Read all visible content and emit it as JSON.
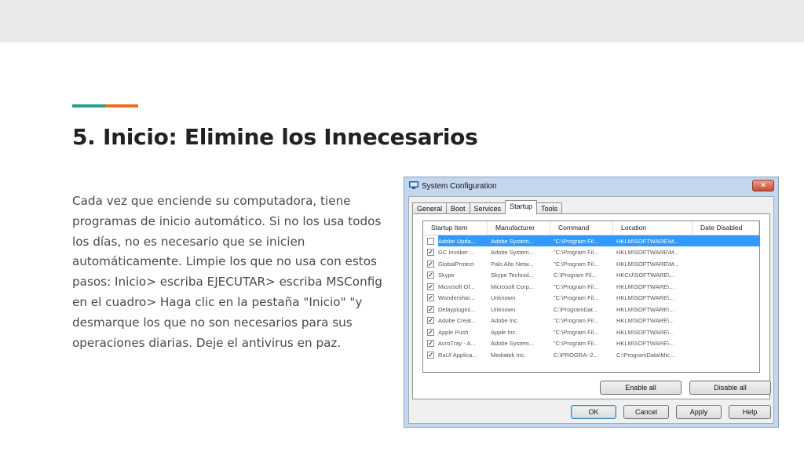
{
  "slide": {
    "title": "5. Inicio: Elimine los Innecesarios",
    "body": "Cada vez que enciende su computadora, tiene programas de inicio automático. Si no los usa todos los días, no es necesario que se inicien automáticamente. Limpie los que no usa con estos pasos: Inicio> escriba EJECUTAR> escriba MSConfig en el cuadro> Haga clic en la pestaña \"Inicio\" \"y desmarque los que no son necesarios para sus operaciones diarias. Deje el antivirus en paz.",
    "accent_colors": [
      "#2a9d8f",
      "#e76f24"
    ]
  },
  "dialog": {
    "title": "System Configuration",
    "close_label": "×",
    "tabs": [
      {
        "label": "General",
        "active": false
      },
      {
        "label": "Boot",
        "active": false
      },
      {
        "label": "Services",
        "active": false
      },
      {
        "label": "Startup",
        "active": true
      },
      {
        "label": "Tools",
        "active": false
      }
    ],
    "columns": [
      "Startup Item",
      "Manufacturer",
      "Command",
      "Location",
      "Date Disabled"
    ],
    "rows": [
      {
        "checked": false,
        "selected": true,
        "item": "Adobe Upda...",
        "manufacturer": "Adobe System...",
        "command": "\"C:\\Program Fil...",
        "location": "HKLM\\SOFTWARE\\M...",
        "date": ""
      },
      {
        "checked": true,
        "selected": false,
        "item": "GC Invoker ...",
        "manufacturer": "Adobe System...",
        "command": "\"C:\\Program Fil...",
        "location": "HKLM\\SOFTWARE\\M...",
        "date": ""
      },
      {
        "checked": true,
        "selected": false,
        "item": "GlobalProtect",
        "manufacturer": "Palo Alto Netw...",
        "command": "\"C:\\Program Fil...",
        "location": "HKLM\\SOFTWARE\\M...",
        "date": ""
      },
      {
        "checked": true,
        "selected": false,
        "item": "Skype",
        "manufacturer": "Skype Technol...",
        "command": "C:\\Program Fil...",
        "location": "HKCU\\SOFTWARE\\...",
        "date": ""
      },
      {
        "checked": true,
        "selected": false,
        "item": "Microsoft Of...",
        "manufacturer": "Microsoft Corp...",
        "command": "\"C:\\Program Fil...",
        "location": "HKLM\\SOFTWARE\\...",
        "date": ""
      },
      {
        "checked": true,
        "selected": false,
        "item": "Wondershar...",
        "manufacturer": "Unknown",
        "command": "\"C:\\Program Fil...",
        "location": "HKLM\\SOFTWARE\\...",
        "date": ""
      },
      {
        "checked": true,
        "selected": false,
        "item": "Delaypluginl...",
        "manufacturer": "Unknown",
        "command": "C:\\ProgramDat...",
        "location": "HKLM\\SOFTWARE\\...",
        "date": ""
      },
      {
        "checked": true,
        "selected": false,
        "item": "Adobe Creat...",
        "manufacturer": "Adobe Inc.",
        "command": "\"C:\\Program Fil...",
        "location": "HKLM\\SOFTWARE\\...",
        "date": ""
      },
      {
        "checked": true,
        "selected": false,
        "item": "Apple Push",
        "manufacturer": "Apple Inc.",
        "command": "\"C:\\Program Fil...",
        "location": "HKLM\\SOFTWARE\\...",
        "date": ""
      },
      {
        "checked": true,
        "selected": false,
        "item": "AcroTray - A...",
        "manufacturer": "Adobe System...",
        "command": "\"C:\\Program Fil...",
        "location": "HKLM\\SOFTWARE\\...",
        "date": ""
      },
      {
        "checked": true,
        "selected": false,
        "item": "RaUI Applica...",
        "manufacturer": "Mediatek Inc.",
        "command": "C:\\PROGRA~2...",
        "location": "C:\\ProgramData\\Mic...",
        "date": ""
      }
    ],
    "buttons": {
      "enable_all": "Enable all",
      "disable_all": "Disable all",
      "ok": "OK",
      "cancel": "Cancel",
      "apply": "Apply",
      "help": "Help"
    }
  }
}
